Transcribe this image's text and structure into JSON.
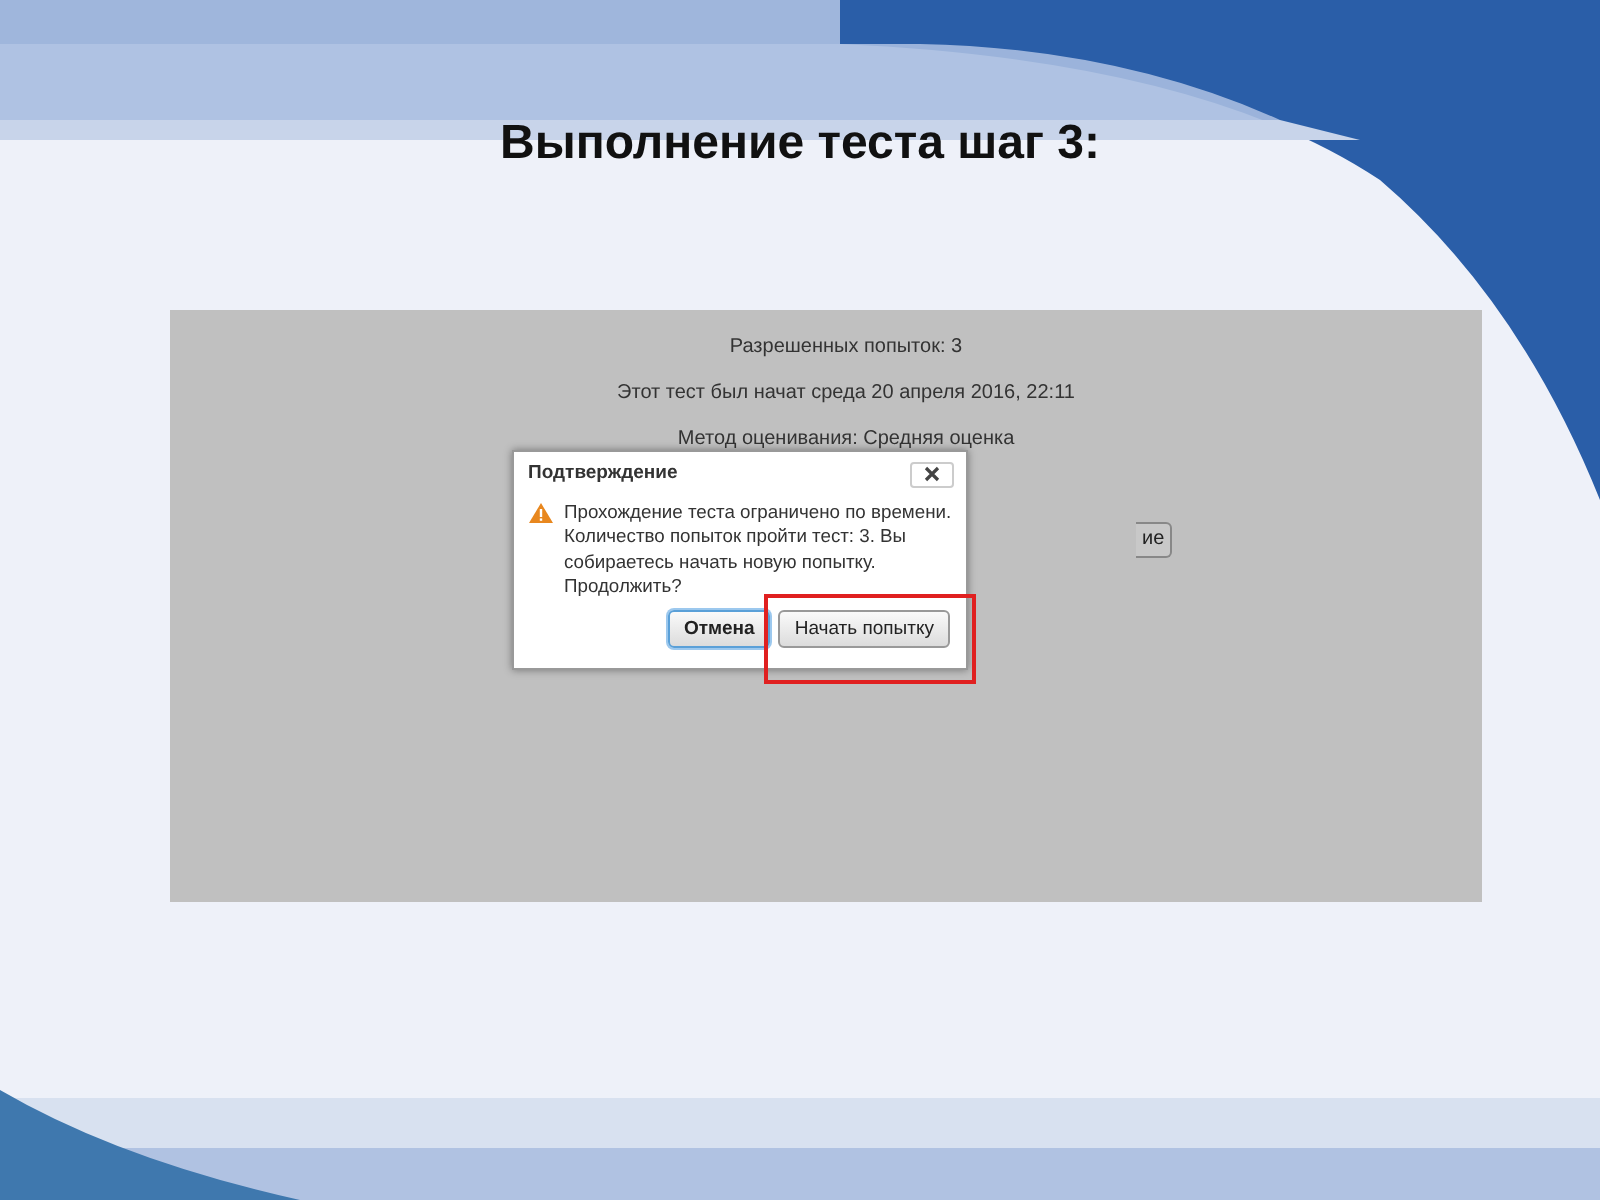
{
  "slide": {
    "title": "Выполнение теста шаг 3:"
  },
  "screenshot": {
    "info_lines": [
      "Разрешенных попыток: 3",
      "Этот тест был начат среда 20 апреля 2016, 22:11",
      "Метод оценивания: Средняя оценка"
    ],
    "background_button": "ие",
    "dialog": {
      "title": "Подтверждение",
      "message": "Прохождение теста ограничено по времени. Количество попыток пройти тест: 3. Вы собираетесь начать новую попытку. Продолжить?",
      "buttons": [
        {
          "label": "Отмена",
          "focused": true,
          "highlighted": false
        },
        {
          "label": "Начать попытку",
          "focused": false,
          "highlighted": true
        }
      ]
    }
  }
}
